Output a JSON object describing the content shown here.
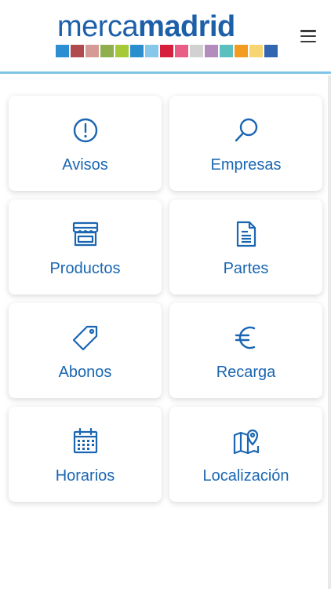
{
  "header": {
    "logo_light": "merca",
    "logo_bold": "madrid",
    "stripe_colors": [
      "#2d8fd3",
      "#b04a4e",
      "#d59a96",
      "#8fae4e",
      "#a6c93a",
      "#2a8ecf",
      "#86c8ea",
      "#d51f3b",
      "#e85e86",
      "#d1d1d1",
      "#b38bbd",
      "#5bbfc0",
      "#f29b1f",
      "#f7d671",
      "#3366b0"
    ],
    "menu_icon": "hamburger-menu-icon"
  },
  "tiles": [
    {
      "label": "Avisos",
      "icon": "exclamation-circle-icon"
    },
    {
      "label": "Empresas",
      "icon": "search-icon"
    },
    {
      "label": "Productos",
      "icon": "store-icon"
    },
    {
      "label": "Partes",
      "icon": "document-icon"
    },
    {
      "label": "Abonos",
      "icon": "price-tag-icon"
    },
    {
      "label": "Recarga",
      "icon": "euro-icon"
    },
    {
      "label": "Horarios",
      "icon": "calendar-icon"
    },
    {
      "label": "Localización",
      "icon": "map-pin-icon"
    }
  ],
  "colors": {
    "accent": "#1a66b2",
    "header_border": "#7fc4e8",
    "background": "#ffffff"
  }
}
